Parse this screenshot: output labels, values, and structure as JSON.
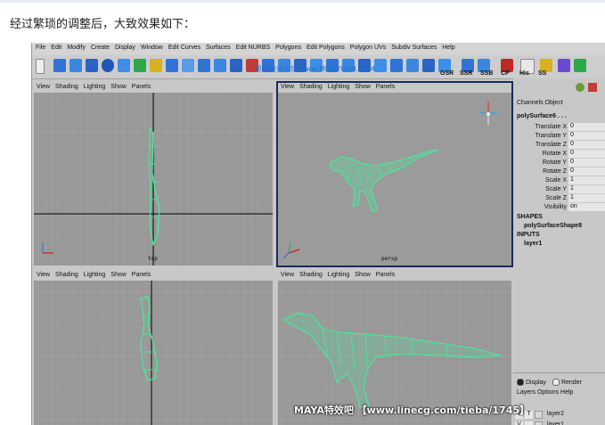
{
  "caption": "经过繁琐的调整后，大致效果如下：",
  "menubar": [
    "File",
    "Edit",
    "Modify",
    "Create",
    "Display",
    "Window",
    "Edit Curves",
    "Surfaces",
    "Edit NURBS",
    "Polygons",
    "Edit Polygons",
    "Polygon UVs",
    "Subdiv Surfaces",
    "Help"
  ],
  "shelf": {
    "watermark": "思缘设计论坛   www.MISSYUAN.COM",
    "labels": [
      "GSR",
      "SSR",
      "SSB",
      "CP",
      "His",
      "SS"
    ]
  },
  "viewport_menu": [
    "View",
    "Shading",
    "Lighting",
    "Show",
    "Panels"
  ],
  "viewports": {
    "top": {
      "label": "top"
    },
    "persp": {
      "label": "persp"
    }
  },
  "channel_box": {
    "tabs": [
      "Channels",
      "Object"
    ],
    "object_name": "polySurface6 . . .",
    "channels": [
      {
        "name": "Translate X",
        "value": "0"
      },
      {
        "name": "Translate Y",
        "value": "0"
      },
      {
        "name": "Translate Z",
        "value": "0"
      },
      {
        "name": "Rotate X",
        "value": "0"
      },
      {
        "name": "Rotate Y",
        "value": "0"
      },
      {
        "name": "Rotate Z",
        "value": "0"
      },
      {
        "name": "Scale X",
        "value": "1"
      },
      {
        "name": "Scale Y",
        "value": "1"
      },
      {
        "name": "Scale Z",
        "value": "1"
      },
      {
        "name": "Visibility",
        "value": "on"
      }
    ],
    "shapes_header": "SHAPES",
    "shape_name": "polySurfaceShape8",
    "inputs_header": "INPUTS",
    "input_name": "layer1"
  },
  "layer_editor": {
    "display_radio": "Display",
    "render_radio": "Render",
    "menu": [
      "Layers",
      "Options",
      "Help"
    ],
    "layers": [
      {
        "v": "V",
        "t": "T",
        "name": "layer2"
      },
      {
        "v": "V",
        "t": "",
        "name": "layer1"
      }
    ]
  },
  "bottom_watermark": "MAYA特效吧  【www.linecg.com/tieba/1745】",
  "colors": {
    "mesh": "#3cf29a",
    "viewport_bg": "#9b9b9b",
    "active_border": "#1a2a5a"
  }
}
